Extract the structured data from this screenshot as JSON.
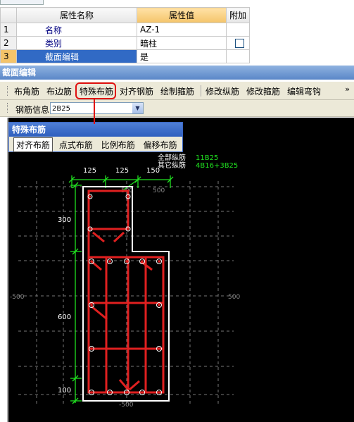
{
  "properties": {
    "headers": {
      "name": "属性名称",
      "value": "属性值",
      "extra": "附加"
    },
    "rows": [
      {
        "num": "1",
        "name": "名称",
        "value": "AZ-1",
        "extra": ""
      },
      {
        "num": "2",
        "name": "类别",
        "value": "暗柱",
        "extra": "checkbox"
      },
      {
        "num": "3",
        "name": "截面编辑",
        "value": "是",
        "extra": ""
      }
    ]
  },
  "window": {
    "title": "截面编辑"
  },
  "toolbar": {
    "items": [
      "布角筋",
      "布边筋",
      "特殊布筋",
      "对齐钢筋",
      "绘制箍筋",
      "修改纵筋",
      "修改箍筋",
      "编辑弯钩"
    ],
    "overflow": "»"
  },
  "rebar_info": {
    "label": "钢筋信息",
    "value": "2B25"
  },
  "popup": {
    "title": "特殊布筋",
    "options": [
      "对齐布筋",
      "点式布筋",
      "比例布筋",
      "偏移布筋"
    ]
  },
  "drawing": {
    "info_labels": [
      "全部纵筋",
      "其它纵筋"
    ],
    "info_values": [
      "11B25",
      "4B16+3B25"
    ],
    "top_dims": [
      "125",
      "125",
      "150"
    ],
    "left_dims": [
      "300",
      "600",
      "100"
    ],
    "axis_labels": [
      "-500",
      "500",
      "-500",
      "500",
      "500"
    ],
    "colors": {
      "rebar": "#e02020",
      "dimension": "#20e020",
      "outline": "#ffffff",
      "grid": "#888888",
      "highlight": "#e01010"
    }
  }
}
